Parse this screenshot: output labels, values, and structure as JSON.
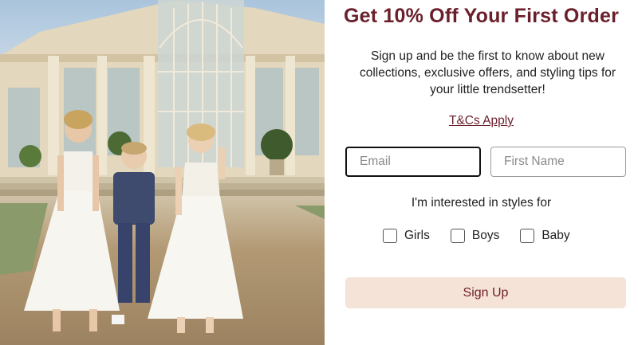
{
  "hero": {
    "image_subject": "children-in-formal-wear-photo"
  },
  "popup": {
    "headline": "Get 10% Off Your First Order",
    "subtext": "Sign up and be the first to know about new collections, exclusive offers, and styling tips for your little trendsetter!",
    "terms_link": "T&Cs Apply",
    "email_placeholder": "Email",
    "first_name_placeholder": "First Name",
    "interest_label": "I'm interested in styles for",
    "options": [
      {
        "label": "Girls",
        "checked": false
      },
      {
        "label": "Boys",
        "checked": false
      },
      {
        "label": "Baby",
        "checked": false
      }
    ],
    "signup_label": "Sign Up"
  },
  "colors": {
    "accent": "#6b1f2a",
    "button_bg": "#f6e3d7"
  }
}
